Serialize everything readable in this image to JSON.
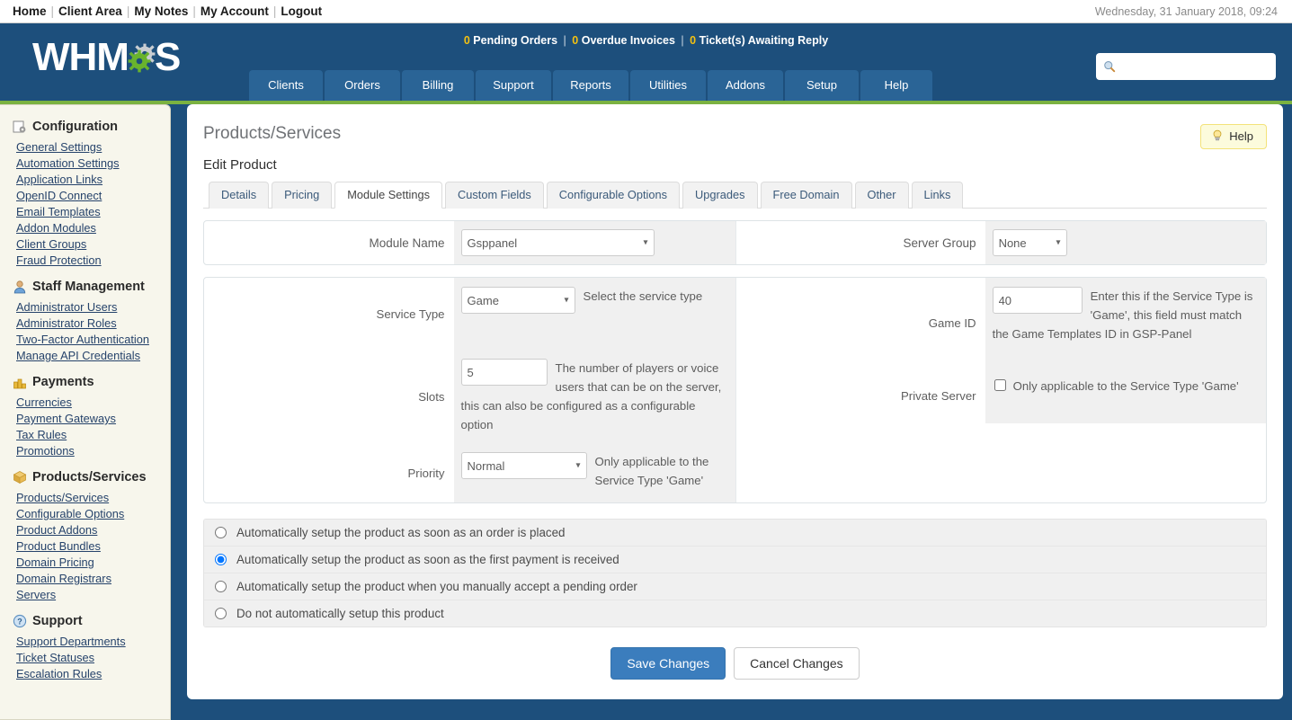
{
  "topbar": {
    "links": [
      "Home",
      "Client Area",
      "My Notes",
      "My Account",
      "Logout"
    ],
    "datetime": "Wednesday, 31 January 2018, 09:24"
  },
  "header": {
    "brand_prefix": "WHM",
    "brand_suffix": "S",
    "status": {
      "pending_count": "0",
      "pending_label": "Pending Orders",
      "overdue_count": "0",
      "overdue_label": "Overdue Invoices",
      "tickets_count": "0",
      "tickets_label": "Ticket(s) Awaiting Reply"
    },
    "search": {
      "value": "",
      "placeholder": ""
    },
    "nav": [
      "Clients",
      "Orders",
      "Billing",
      "Support",
      "Reports",
      "Utilities",
      "Addons",
      "Setup",
      "Help"
    ],
    "colors": {
      "band": "#1d4f7c",
      "tab": "#2a6496",
      "accent_green": "#7bb241",
      "status_num": "#f3c111"
    }
  },
  "sidebar": {
    "groups": [
      {
        "icon": "configuration-icon",
        "title": "Configuration",
        "items": [
          "General Settings",
          "Automation Settings",
          "Application Links",
          "OpenID Connect",
          "Email Templates",
          "Addon Modules",
          "Client Groups",
          "Fraud Protection"
        ]
      },
      {
        "icon": "staff-icon",
        "title": "Staff Management",
        "items": [
          "Administrator Users",
          "Administrator Roles",
          "Two-Factor Authentication",
          "Manage API Credentials"
        ]
      },
      {
        "icon": "payments-icon",
        "title": "Payments",
        "items": [
          "Currencies",
          "Payment Gateways",
          "Tax Rules",
          "Promotions"
        ]
      },
      {
        "icon": "products-icon",
        "title": "Products/Services",
        "items": [
          "Products/Services",
          "Configurable Options",
          "Product Addons",
          "Product Bundles",
          "Domain Pricing",
          "Domain Registrars",
          "Servers"
        ]
      },
      {
        "icon": "support-icon",
        "title": "Support",
        "items": [
          "Support Departments",
          "Ticket Statuses",
          "Escalation Rules"
        ]
      }
    ]
  },
  "main": {
    "page_title": "Products/Services",
    "section_title": "Edit Product",
    "help_button": "Help",
    "tabs": [
      {
        "label": "Details",
        "active": false
      },
      {
        "label": "Pricing",
        "active": false
      },
      {
        "label": "Module Settings",
        "active": true
      },
      {
        "label": "Custom Fields",
        "active": false
      },
      {
        "label": "Configurable Options",
        "active": false
      },
      {
        "label": "Upgrades",
        "active": false
      },
      {
        "label": "Free Domain",
        "active": false
      },
      {
        "label": "Other",
        "active": false
      },
      {
        "label": "Links",
        "active": false
      }
    ],
    "module_row": {
      "module_name_label": "Module Name",
      "module_name_value": "Gsppanel",
      "server_group_label": "Server Group",
      "server_group_value": "None"
    },
    "settings": {
      "left": [
        {
          "label": "Service Type",
          "control": "select",
          "value": "Game",
          "help": "Select the service type"
        },
        {
          "label": "Slots",
          "control": "text",
          "value": "5",
          "help": "The number of players or voice users that can be on the server, this can also be configured as a configurable option"
        },
        {
          "label": "Priority",
          "control": "select",
          "value": "Normal",
          "help": "Only applicable to the Service Type 'Game'"
        }
      ],
      "right": [
        {
          "label": "Game ID",
          "control": "text",
          "value": "40",
          "help": "Enter this if the Service Type is 'Game', this field must match the Game Templates ID in GSP-Panel"
        },
        {
          "label": "Private Server",
          "control": "checkbox",
          "checked": false,
          "help": "Only applicable to the Service Type 'Game'"
        }
      ]
    },
    "auto_setup": {
      "options": [
        {
          "label": "Automatically setup the product as soon as an order is placed",
          "selected": false
        },
        {
          "label": "Automatically setup the product as soon as the first payment is received",
          "selected": true
        },
        {
          "label": "Automatically setup the product when you manually accept a pending order",
          "selected": false
        },
        {
          "label": "Do not automatically setup this product",
          "selected": false
        }
      ]
    },
    "buttons": {
      "save": "Save Changes",
      "cancel": "Cancel Changes"
    }
  }
}
